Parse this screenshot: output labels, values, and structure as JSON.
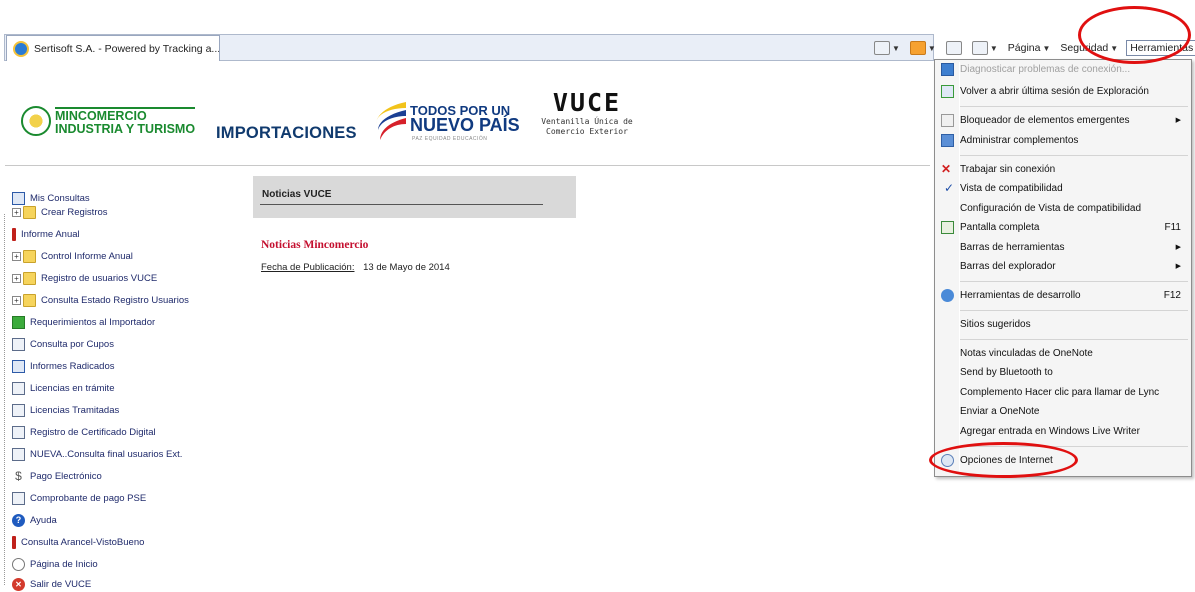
{
  "browser": {
    "tab_title": "Sertisoft S.A. - Powered by Tracking a...",
    "commands": {
      "pagina": "Página",
      "seguridad": "Seguridad",
      "herramientas": "Herramientas"
    }
  },
  "header": {
    "ministry_line1": "MINCOMERCIO",
    "ministry_line2": "INDUSTRIA Y TURISMO",
    "section": "IMPORTACIONES",
    "todos_line1": "TODOS POR UN",
    "todos_line2": "NUEVO PAÍS",
    "todos_line3": "PAZ EQUIDAD EDUCACIÓN",
    "vuce_title": "VUCE",
    "vuce_sub1": "Ventanilla Única de",
    "vuce_sub2": "Comercio Exterior"
  },
  "nav": {
    "items": [
      {
        "label": "Mis Consultas"
      },
      {
        "label": "Crear Registros"
      },
      {
        "label": "Informe Anual"
      },
      {
        "label": "Control Informe Anual"
      },
      {
        "label": "Registro de usuarios VUCE"
      },
      {
        "label": "Consulta Estado Registro Usuarios"
      },
      {
        "label": "Requerimientos al Importador"
      },
      {
        "label": "Consulta por Cupos"
      },
      {
        "label": "Informes Radicados"
      },
      {
        "label": "Licencias en trámite"
      },
      {
        "label": "Licencias Tramitadas"
      },
      {
        "label": "Registro de Certificado Digital"
      },
      {
        "label": "NUEVA..Consulta final usuarios Ext."
      },
      {
        "label": "Pago Electrónico"
      },
      {
        "label": "Comprobante de pago PSE"
      },
      {
        "label": "Ayuda"
      },
      {
        "label": "Consulta Arancel-VistoBueno"
      },
      {
        "label": "Página de Inicio"
      },
      {
        "label": "Salir de VUCE"
      }
    ]
  },
  "news": {
    "heading": "Noticias VUCE",
    "mincomercio_title": "Noticias Mincomercio",
    "fecha_label": "Fecha de Publicación:",
    "fecha_value": "13 de Mayo de 2014"
  },
  "tools_menu": {
    "items": [
      {
        "label": "Diagnosticar problemas de conexión..."
      },
      {
        "label": "Volver a abrir última sesión de Exploración"
      },
      {
        "label": "Bloqueador de elementos emergentes"
      },
      {
        "label": "Administrar complementos"
      },
      {
        "label": "Trabajar sin conexión"
      },
      {
        "label": "Vista de compatibilidad"
      },
      {
        "label": "Configuración de Vista de compatibilidad"
      },
      {
        "label": "Pantalla completa",
        "shortcut": "F11"
      },
      {
        "label": "Barras de herramientas"
      },
      {
        "label": "Barras del explorador"
      },
      {
        "label": "Herramientas de desarrollo",
        "shortcut": "F12"
      },
      {
        "label": "Sitios sugeridos"
      },
      {
        "label": "Notas vinculadas de OneNote"
      },
      {
        "label": "Send by Bluetooth to"
      },
      {
        "label": "Complemento Hacer clic para llamar de Lync"
      },
      {
        "label": "Enviar a OneNote"
      },
      {
        "label": "Agregar entrada en Windows Live Writer"
      },
      {
        "label": "Opciones de Internet"
      }
    ]
  },
  "colors": {
    "annotation_red": "#e01010",
    "news_red": "#c40f2f",
    "ministry_green": "#1a8a2f",
    "nav_text": "#1f2a6b"
  }
}
